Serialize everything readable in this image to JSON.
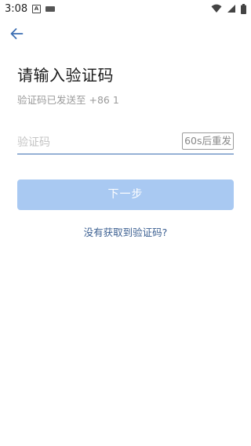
{
  "status_bar": {
    "time": "3:08",
    "left_icons": [
      "text-a-icon",
      "keyboard-icon"
    ],
    "right_icons": [
      "wifi-icon",
      "signal-icon",
      "battery-icon"
    ]
  },
  "header": {
    "back_icon": "arrow-left-icon"
  },
  "page": {
    "title": "请输入验证码",
    "sent_hint": "验证码已发送至 +86 1"
  },
  "code_input": {
    "placeholder": "验证码",
    "value": "",
    "resend_label": "60s后重发"
  },
  "next_button": {
    "label": "下一步",
    "color": "#a9c9f2"
  },
  "no_code_link": "没有获取到验证码?",
  "colors": {
    "accent": "#3d6fb3",
    "link": "#3b5f91"
  }
}
